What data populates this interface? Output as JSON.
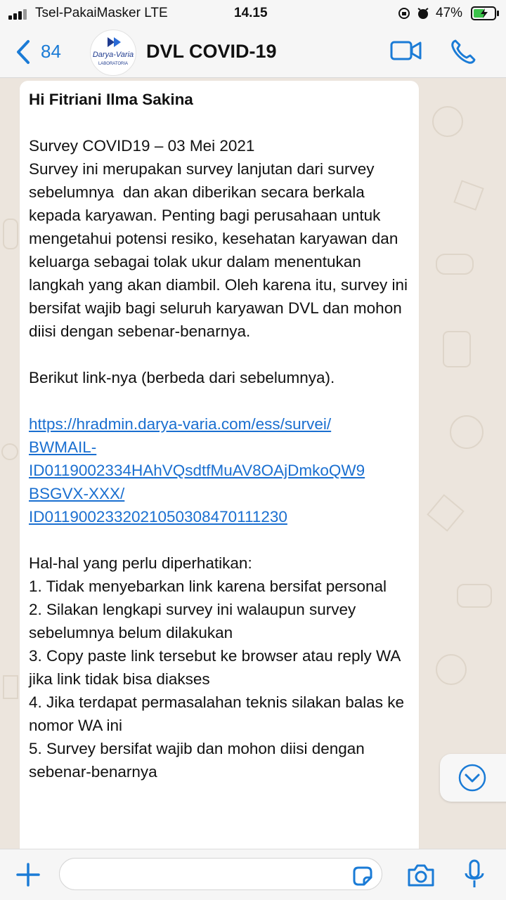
{
  "status_bar": {
    "carrier": "Tsel-PakaiMasker  LTE",
    "time": "14.15",
    "battery": "47%"
  },
  "header": {
    "back_count": "84",
    "title": "DVL COVID-19",
    "avatar_logo_text": "Darya-Varia",
    "avatar_logo_subtext": "LABORATORIA"
  },
  "message": {
    "greeting": "Hi Fitriani Ilma Sakina",
    "body": "\n\nSurvey COVID19 – 03 Mei 2021\nSurvey ini merupakan survey lanjutan dari survey sebelumnya  dan akan diberikan secara berkala kepada karyawan. Penting bagi perusahaan untuk mengetahui potensi resiko, kesehatan karyawan dan keluarga sebagai tolak ukur dalam menentukan langkah yang akan diambil. Oleh karena itu, survey ini bersifat wajib bagi seluruh karyawan DVL dan mohon diisi dengan sebenar-benarnya.\n\nBerikut link-nya (berbeda dari sebelumnya).\n\n",
    "link": "https://hradmin.darya-varia.com/ess/survei/\nBWMAIL-\nID0119002334HAhVQsdtfMuAV8OAjDmkoQW9\nBSGVX-XXX/\nID01190023320210503084701​11230",
    "notes": "\n\nHal-hal yang perlu diperhatikan:\n1. Tidak menyebarkan link karena bersifat personal\n2. Silakan lengkapi survey ini walaupun survey sebelumnya belum dilakukan\n3. Copy paste link tersebut ke browser atau reply WA jika link tidak bisa diakses\n4. Jika terdapat permasalahan teknis silakan balas ke nomor WA ini\n5. Survey bersifat wajib dan mohon diisi dengan sebenar-benarnya"
  },
  "input": {
    "placeholder": ""
  },
  "colors": {
    "accent": "#1a7bd6",
    "link": "#1a6fd0",
    "chat_bg": "#ece5dd",
    "bubble": "#ffffff"
  }
}
